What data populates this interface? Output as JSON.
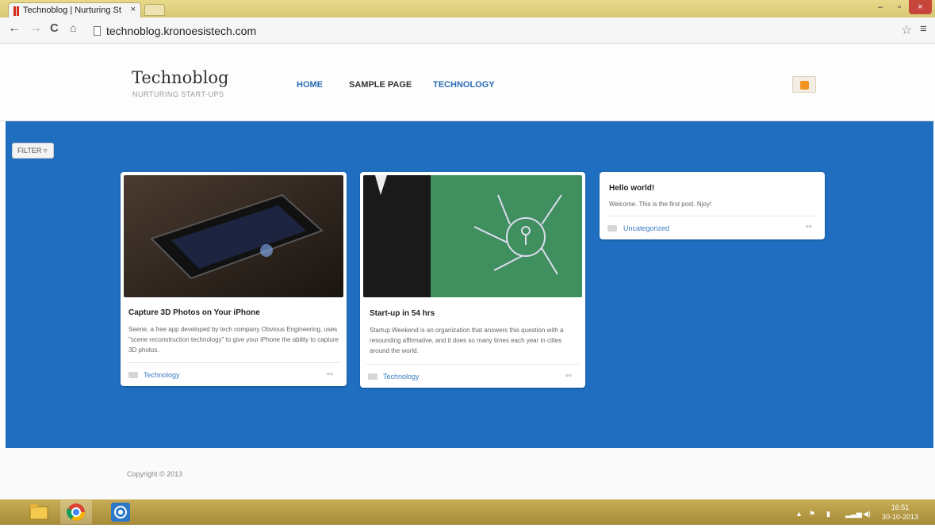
{
  "browser": {
    "tab_title": "Technoblog | Nurturing St",
    "tab_close": "×",
    "url": "technoblog.kronoesistech.com",
    "window_controls": {
      "minimize": "–",
      "maximize": "▫",
      "close": "×"
    }
  },
  "site": {
    "title": "Technoblog",
    "tagline": "NURTURING START-UPS",
    "nav": [
      "HOME",
      "SAMPLE PAGE",
      "TECHNOLOGY"
    ],
    "rss_icon": "rss-icon"
  },
  "filter_label": "FILTER",
  "posts": [
    {
      "title": "Capture 3D Photos on Your iPhone",
      "excerpt": "Seene, a free app developed by tech company Obvious Engineering, uses \"scene reconstruction technology\" to give your iPhone the ability to capture 3D photos.",
      "category": "Technology"
    },
    {
      "title": "Start-up in 54 hrs",
      "excerpt": "Startup Weekend is an organization that answers this question with a resounding affirmative, and it does so many times each year in cities around the world.",
      "category": "Technology"
    },
    {
      "title": "Hello world!",
      "excerpt": "Welcome. This is the first post. Njoy!",
      "category": "Uncategorized"
    }
  ],
  "footer": {
    "copyright": "Copyright © 2013"
  },
  "taskbar": {
    "time": "16:51",
    "date": "30-10-2013"
  },
  "colors": {
    "accent": "#2a6eb5",
    "band": "#1f6ebf"
  }
}
